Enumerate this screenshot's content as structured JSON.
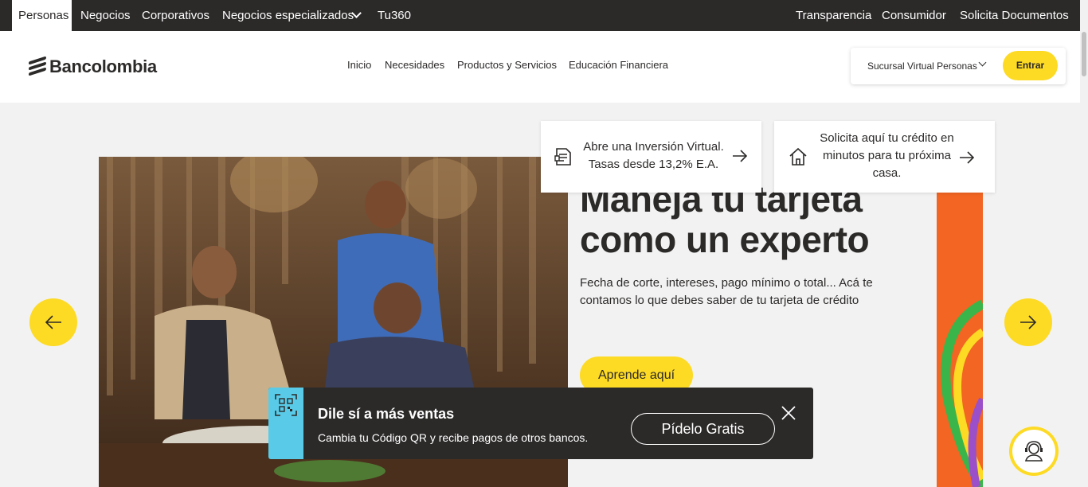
{
  "topbar": {
    "segments": [
      "Personas",
      "Negocios",
      "Corporativos",
      "Negocios especializados",
      "Tu360"
    ],
    "right_links": [
      "Transparencia",
      "Consumidor",
      "Solicita Documentos"
    ]
  },
  "header": {
    "logo": "Bancolombia",
    "nav": [
      "Inicio",
      "Necesidades",
      "Productos y Servicios",
      "Educación Financiera"
    ],
    "sucursal": "Sucursal Virtual Personas",
    "login": "Entrar"
  },
  "quick_cards": [
    {
      "lines": [
        "Abre una Inversión Virtual.",
        "Tasas desde 13,2% E.A."
      ],
      "icon": "document-icon"
    },
    {
      "lines": [
        "Solicita aquí tu crédito en",
        "minutos para tu próxima",
        "casa."
      ],
      "icon": "house-icon"
    }
  ],
  "hero": {
    "title_lines": [
      "Maneja tu tarjeta",
      "como un experto"
    ],
    "description": "Fecha de corte, intereses, pago mínimo o total... Acá te contamos lo que debes saber de tu tarjeta de crédito",
    "cta": "Aprende aquí"
  },
  "promo": {
    "title": "Dile sí a más ventas",
    "subtitle": "Cambia tu Código QR y recibe pagos de otros bancos.",
    "button": "Pídelo Gratis"
  },
  "colors": {
    "brand_yellow": "#fdda24",
    "dark": "#2c2a29",
    "qr_blue": "#59cbe8",
    "orange": "#f26522"
  }
}
